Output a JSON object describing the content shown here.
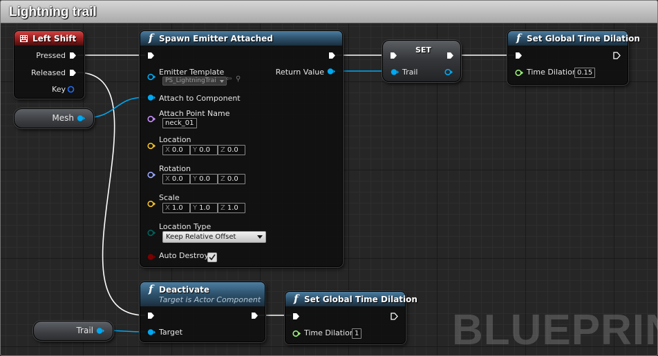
{
  "comment": {
    "title": "Lightning trail"
  },
  "watermark": "BLUEPRINT",
  "colors": {
    "object_pin": "#00a8f2",
    "float_pin": "#9cf07a",
    "name_pin": "#c78fff",
    "vector_pin": "#f3c12b",
    "rotator_pin": "#9aa6ff",
    "enum_pin": "#00615a",
    "bool_pin": "#7c0000",
    "exec_pin": "#ffffff",
    "event_header": "#b21c1c",
    "function_header": "#38617f"
  },
  "nodes": {
    "left_shift": {
      "title": "Left Shift",
      "icon": "keyboard-icon",
      "pins": {
        "pressed": "Pressed",
        "released": "Released",
        "key": "Key"
      }
    },
    "spawn": {
      "title": "Spawn Emitter Attached",
      "icon": "function-icon",
      "pins": {
        "emitter_template": "Emitter Template",
        "emitter_value": "PS_LightningTrai",
        "attach_to_component": "Attach to Component",
        "attach_point_name": "Attach Point Name",
        "attach_point_value": "neck_01",
        "location": "Location",
        "location_xyz": [
          "0.0",
          "0.0",
          "0.0"
        ],
        "rotation": "Rotation",
        "rotation_xyz": [
          "0.0",
          "0.0",
          "0.0"
        ],
        "scale": "Scale",
        "scale_xyz": [
          "1.0",
          "1.0",
          "1.0"
        ],
        "location_type": "Location Type",
        "location_type_value": "Keep Relative Offset",
        "auto_destroy": "Auto Destroy",
        "auto_destroy_checked": true,
        "return_value": "Return Value"
      },
      "axes": [
        "X",
        "Y",
        "Z"
      ]
    },
    "set_trail": {
      "title": "SET",
      "pin": "Trail"
    },
    "time_dilation_1": {
      "title": "Set Global Time Dilation",
      "icon": "function-icon",
      "pin": "Time Dilation",
      "value": "0.15"
    },
    "mesh": {
      "label": "Mesh"
    },
    "deactivate": {
      "title": "Deactivate",
      "subtitle": "Target is Actor Component",
      "icon": "function-icon",
      "pin": "Target"
    },
    "trail_var": {
      "label": "Trail"
    },
    "time_dilation_2": {
      "title": "Set Global Time Dilation",
      "icon": "function-icon",
      "pin": "Time Dilation",
      "value": "1"
    }
  }
}
